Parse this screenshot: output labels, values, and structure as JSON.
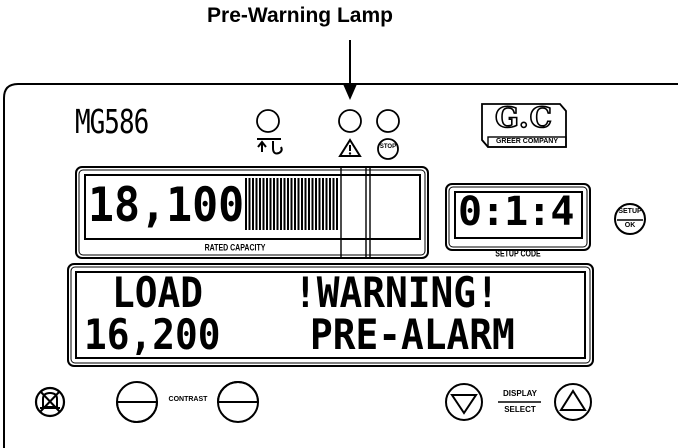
{
  "callout": {
    "label": "Pre-Warning Lamp"
  },
  "panel": {
    "model": "MG586",
    "brand_logo": "G.C",
    "brand_name": "GREER COMPANY",
    "stop_label": "STOP"
  },
  "capacity_display": {
    "value": "18,100",
    "caption": "RATED CAPACITY",
    "bar_fill_fraction": 0.53
  },
  "setup_display": {
    "value": "0:1:4",
    "caption": "SETUP CODE"
  },
  "setup_button": {
    "top": "SETUP",
    "bottom": "OK"
  },
  "main_display": {
    "line1_left": "LOAD",
    "line1_right": "!WARNING!",
    "line2_left": "16,200",
    "line2_right": "PRE-ALARM"
  },
  "controls": {
    "contrast_label": "CONTRAST",
    "display_select_top": "DISPLAY",
    "display_select_bottom": "SELECT"
  },
  "icons": {
    "lamp_overload": "hook-overload-icon",
    "lamp_prewarning": "warning-triangle-icon",
    "lamp_stop": "stop-octagon-icon",
    "mute": "mute-bell-icon",
    "contrast_down": "contrast-down-icon",
    "contrast_up": "contrast-up-icon",
    "select_down": "down-triangle-icon",
    "select_up": "up-triangle-icon"
  }
}
